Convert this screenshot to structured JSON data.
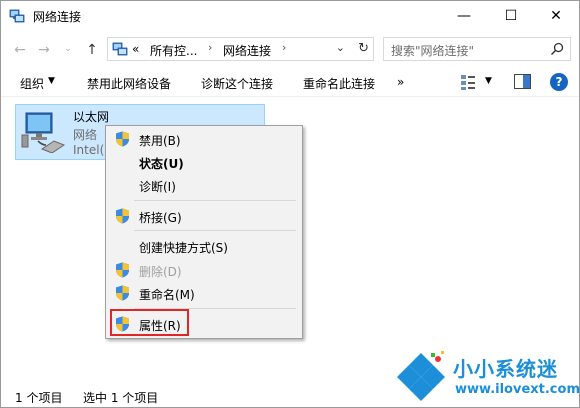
{
  "window": {
    "title": "网络连接",
    "controls": {
      "minimize": "—",
      "maximize": "☐",
      "close": "✕"
    }
  },
  "nav": {
    "back": "←",
    "forward": "→",
    "recent": "⌄",
    "up": "↑",
    "address": {
      "overflow": "«",
      "parts": [
        "所有控...",
        "网络连接"
      ],
      "chevron": "›",
      "dropdown": "⌄",
      "refresh": "↻"
    },
    "search_placeholder": "搜索\"网络连接\""
  },
  "commands": {
    "organize": "组织",
    "organize_caret": "▼",
    "disable": "禁用此网络设备",
    "diagnose": "诊断这个连接",
    "rename": "重命名此连接",
    "more": "»",
    "view_caret": "▼",
    "help": "?"
  },
  "adapter": {
    "name": "以太网",
    "status": "网络",
    "device": "Intel(R"
  },
  "context_menu": {
    "items": [
      {
        "label": "禁用(B)",
        "shield": true,
        "bold": false,
        "disabled": false
      },
      {
        "label": "状态(U)",
        "shield": false,
        "bold": true,
        "disabled": false
      },
      {
        "label": "诊断(I)",
        "shield": false,
        "bold": false,
        "disabled": false
      },
      {
        "label": "桥接(G)",
        "shield": true,
        "bold": false,
        "disabled": false
      },
      {
        "label": "创建快捷方式(S)",
        "shield": false,
        "bold": false,
        "disabled": false
      },
      {
        "label": "删除(D)",
        "shield": true,
        "bold": false,
        "disabled": true
      },
      {
        "label": "重命名(M)",
        "shield": true,
        "bold": false,
        "disabled": false
      },
      {
        "label": "属性(R)",
        "shield": true,
        "bold": false,
        "disabled": false
      }
    ]
  },
  "status_bar": {
    "items_count": "1 个项目",
    "selected": "选中 1 个项目"
  },
  "watermark": {
    "title": "小小系统迷",
    "url": "www.ilovext.com"
  },
  "colors": {
    "selection_bg": "#cce8ff",
    "selection_border": "#99d1ff",
    "highlight_box": "#e02626",
    "help_blue": "#1565c0",
    "watermark_blue": "#1c8fd8"
  }
}
